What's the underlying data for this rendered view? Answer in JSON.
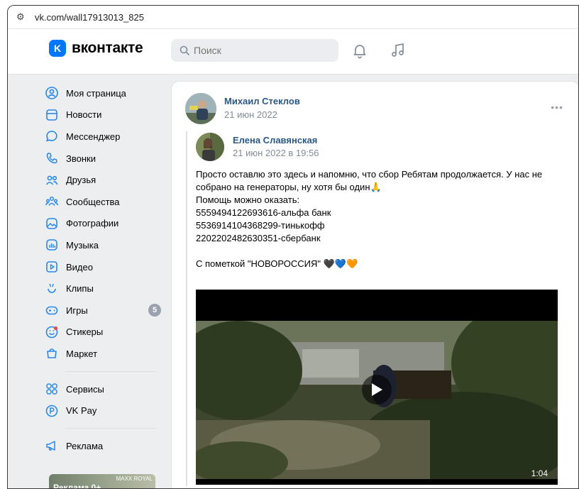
{
  "browser": {
    "url": "vk.com/wall17913013_825"
  },
  "header": {
    "logo_text": "вконтакте",
    "search_placeholder": "Поиск"
  },
  "sidebar": {
    "items": [
      {
        "label": "Моя страница",
        "icon": "user-circle-icon"
      },
      {
        "label": "Новости",
        "icon": "newsfeed-icon"
      },
      {
        "label": "Мессенджер",
        "icon": "message-icon"
      },
      {
        "label": "Звонки",
        "icon": "phone-icon"
      },
      {
        "label": "Друзья",
        "icon": "friends-icon"
      },
      {
        "label": "Сообщества",
        "icon": "communities-icon"
      },
      {
        "label": "Фотографии",
        "icon": "photos-icon"
      },
      {
        "label": "Музыка",
        "icon": "music-icon"
      },
      {
        "label": "Видео",
        "icon": "video-icon"
      },
      {
        "label": "Клипы",
        "icon": "clips-icon"
      },
      {
        "label": "Игры",
        "icon": "games-icon",
        "badge": "5"
      },
      {
        "label": "Стикеры",
        "icon": "stickers-icon"
      },
      {
        "label": "Маркет",
        "icon": "market-icon"
      }
    ],
    "services": [
      {
        "label": "Сервисы",
        "icon": "services-icon"
      },
      {
        "label": "VK Pay",
        "icon": "vkpay-icon"
      }
    ],
    "ads": {
      "label": "Реклама",
      "icon": "ads-icon"
    },
    "ad_banner": {
      "text": "Реклама 0+",
      "brand": "MAXX ROYAL"
    }
  },
  "post": {
    "author": "Михаил Стеклов",
    "date": "21 июн 2022",
    "repost": {
      "author": "Елена Славянская",
      "date": "21 июн 2022 в 19:56",
      "lines": [
        "Просто оставлю это здесь и напомню, что сбор Ребятам продолжается. У нас не собрано на генераторы, ну хотя бы один🙏",
        "Помощь можно оказать:",
        "5559494122693616-альфа банк",
        "5536914104368299-тинькофф",
        "2202202482630351-сбербанк",
        "",
        "С пометкой \"НОВОРОССИЯ\" 🖤💙🧡"
      ],
      "video_duration": "1:04"
    }
  },
  "colors": {
    "accent": "#0077ff",
    "link": "#2a5885",
    "secondary": "#818c99",
    "background": "#edeef0"
  }
}
